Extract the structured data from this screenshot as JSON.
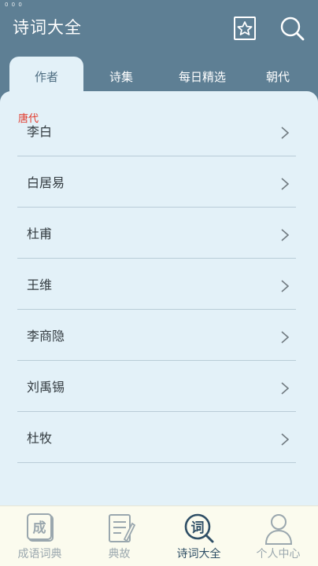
{
  "status": {
    "text": "0 0 0"
  },
  "header": {
    "title": "诗词大全"
  },
  "tabs": [
    {
      "label": "作者",
      "active": true
    },
    {
      "label": "诗集",
      "active": false
    },
    {
      "label": "每日精选",
      "active": false
    },
    {
      "label": "朝代",
      "active": false
    }
  ],
  "section": {
    "label": "唐代"
  },
  "authors": [
    {
      "name": "李白"
    },
    {
      "name": "白居易"
    },
    {
      "name": "杜甫"
    },
    {
      "name": "王维"
    },
    {
      "name": "李商隐"
    },
    {
      "name": "刘禹锡"
    },
    {
      "name": "杜牧"
    }
  ],
  "bottom_nav": [
    {
      "label": "成语词典",
      "icon": "idiom-dictionary-icon",
      "glyph": "成",
      "active": false
    },
    {
      "label": "典故",
      "icon": "allusion-book-icon",
      "glyph": "",
      "active": false
    },
    {
      "label": "诗词大全",
      "icon": "poetry-search-icon",
      "glyph": "词",
      "active": true
    },
    {
      "label": "个人中心",
      "icon": "user-profile-icon",
      "glyph": "",
      "active": false
    }
  ],
  "colors": {
    "header_bg": "#5e7f94",
    "panel_bg": "#e3f1f8",
    "section_red": "#e23a2c",
    "nav_active": "#2f4f66",
    "nav_inactive": "#9aa7ae"
  }
}
